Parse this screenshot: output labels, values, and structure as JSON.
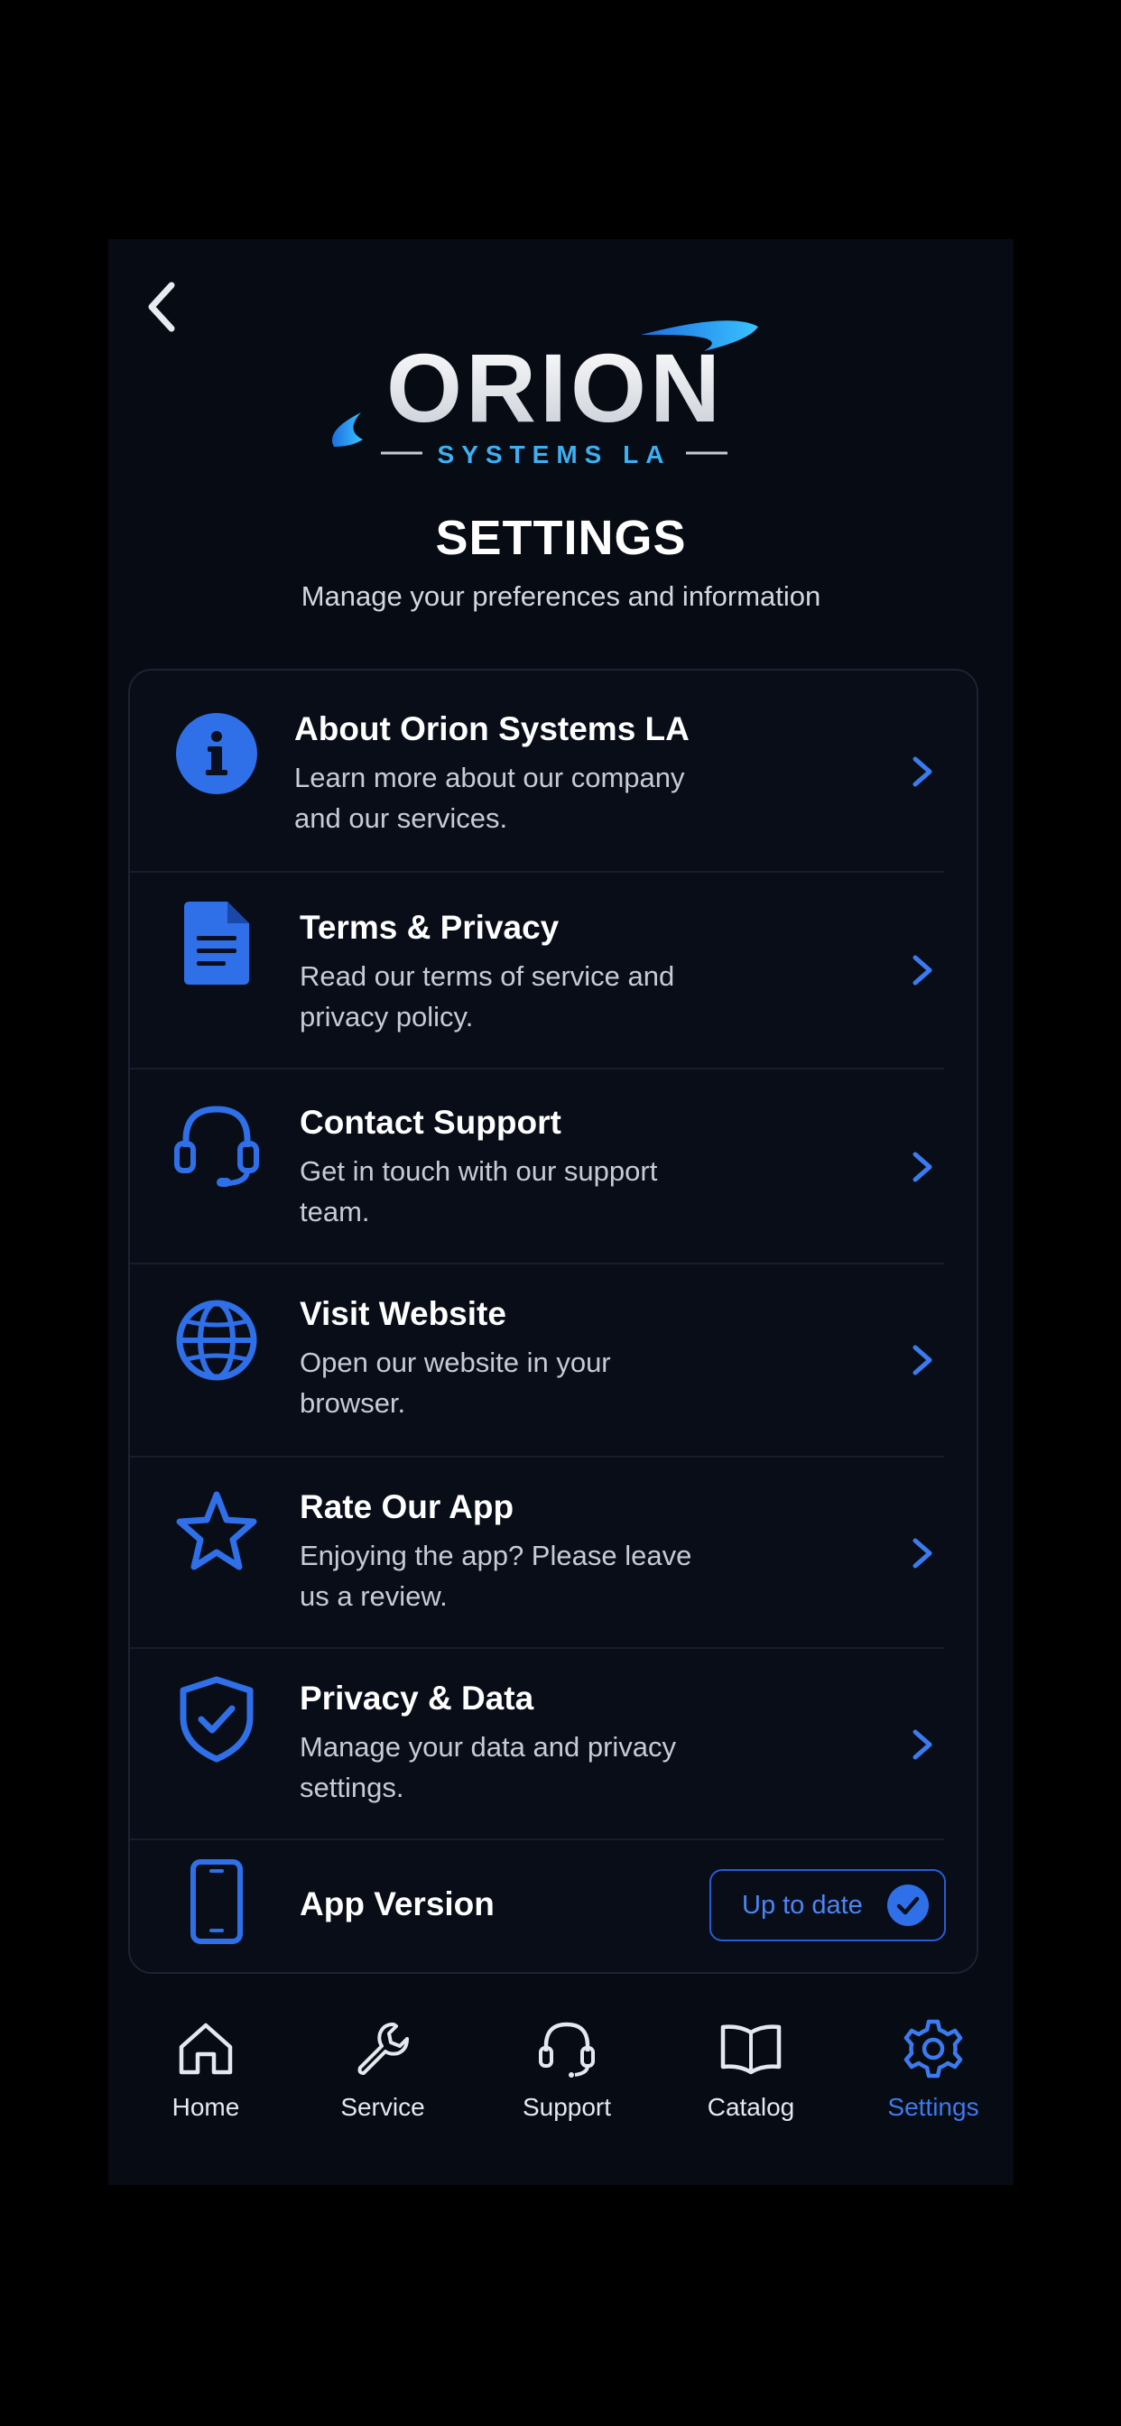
{
  "logo": {
    "brand": "ORION",
    "tagline": "SYSTEMS LA"
  },
  "header": {
    "title": "SETTINGS",
    "subtitle": "Manage your preferences and information"
  },
  "settings": {
    "items": [
      {
        "title": "About Orion Systems LA",
        "description": "Learn more about our company and our services.",
        "icon": "info-icon"
      },
      {
        "title": "Terms & Privacy",
        "description": "Read our terms of service and privacy policy.",
        "icon": "document-icon"
      },
      {
        "title": "Contact Support",
        "description": "Get in touch with our support team.",
        "icon": "headset-icon"
      },
      {
        "title": "Visit Website",
        "description": "Open our website in your browser.",
        "icon": "globe-icon"
      },
      {
        "title": "Rate Our App",
        "description": "Enjoying the app? Please leave us a review.",
        "icon": "star-icon"
      },
      {
        "title": "Privacy & Data",
        "description": "Manage your data and privacy settings.",
        "icon": "shield-check-icon"
      }
    ],
    "version": {
      "title": "App Version",
      "status": "Up to date",
      "icon": "phone-icon"
    }
  },
  "tabs": [
    {
      "label": "Home",
      "icon": "home-icon"
    },
    {
      "label": "Service",
      "icon": "wrench-icon"
    },
    {
      "label": "Support",
      "icon": "headset-icon"
    },
    {
      "label": "Catalog",
      "icon": "book-icon"
    },
    {
      "label": "Settings",
      "icon": "gear-icon",
      "active": true
    }
  ],
  "colors": {
    "accent": "#2f6fe8",
    "background": "#070b14",
    "card": "#080d18"
  }
}
